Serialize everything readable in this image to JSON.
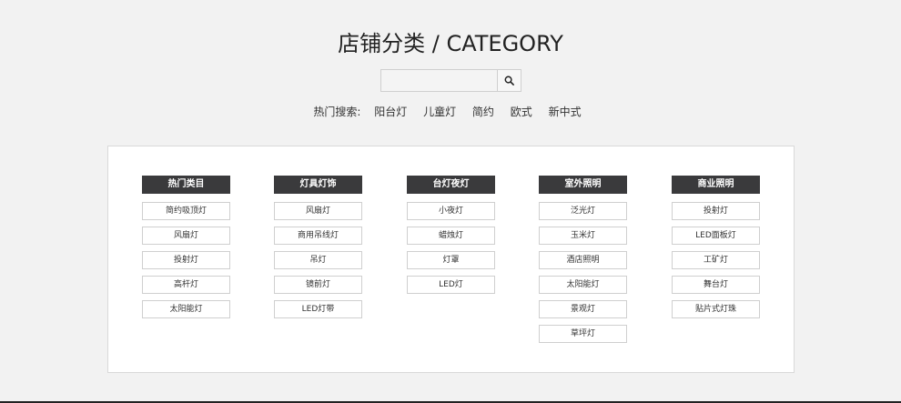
{
  "title": "店铺分类 / CATEGORY",
  "search": {
    "value": "",
    "placeholder": ""
  },
  "hot_search": {
    "label": "热门搜索:",
    "links": [
      "阳台灯",
      "儿童灯",
      "简约",
      "欧式",
      "新中式"
    ]
  },
  "columns": [
    {
      "header": "热门类目",
      "items": [
        "简约吸顶灯",
        "风扇灯",
        "投射灯",
        "高杆灯",
        "太阳能灯"
      ]
    },
    {
      "header": "灯具灯饰",
      "items": [
        "风扇灯",
        "商用吊线灯",
        "吊灯",
        "镜前灯",
        "LED灯带"
      ]
    },
    {
      "header": "台灯夜灯",
      "items": [
        "小夜灯",
        "蜡烛灯",
        "灯罩",
        "LED灯"
      ]
    },
    {
      "header": "室外照明",
      "items": [
        "泛光灯",
        "玉米灯",
        "酒店照明",
        "太阳能灯",
        "景观灯",
        "草坪灯"
      ]
    },
    {
      "header": "商业照明",
      "items": [
        "投射灯",
        "LED面板灯",
        "工矿灯",
        "舞台灯",
        "贴片式灯珠"
      ]
    }
  ]
}
